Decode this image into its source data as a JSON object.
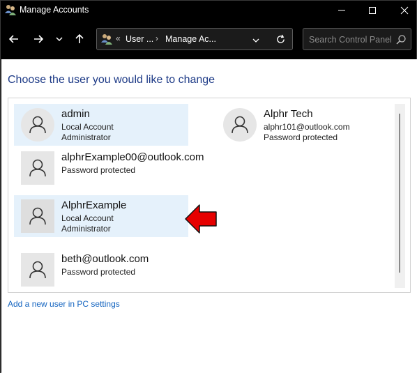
{
  "window": {
    "title": "Manage Accounts"
  },
  "address_bar": {
    "crumbs": [
      "User ...",
      "Manage Ac..."
    ],
    "prefix": "«"
  },
  "search": {
    "placeholder": "Search Control Panel"
  },
  "main": {
    "heading": "Choose the user you would like to change",
    "accounts": [
      {
        "name": "admin",
        "line1": "Local Account",
        "line2": "Administrator",
        "selected": true
      },
      {
        "name": "Alphr Tech",
        "line1": "alphr101@outlook.com",
        "line2": "Password protected",
        "selected": false
      },
      {
        "name": "alphrExample00@outlook.com",
        "line1": "Password protected",
        "line2": "",
        "selected": false
      },
      {
        "name": "AlphrExample",
        "line1": "Local Account",
        "line2": "Administrator",
        "selected": true
      },
      {
        "name": "beth@outlook.com",
        "line1": "Password protected",
        "line2": "",
        "selected": false
      }
    ],
    "add_link": "Add a new user in PC settings"
  },
  "colors": {
    "heading": "#1e3b87",
    "link": "#1565c0",
    "selected_bg": "#e5f1fb",
    "annotation_arrow": "#e60000"
  }
}
